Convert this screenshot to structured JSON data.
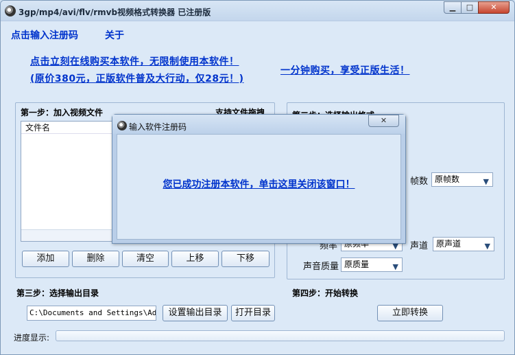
{
  "window": {
    "title": "3gp/mp4/avi/flv/rmvb视频格式转换器  已注册版",
    "min_icon": "▁",
    "max_icon": "□",
    "close_icon": "✕"
  },
  "menu": {
    "register": "点击输入注册码",
    "about": "关于"
  },
  "promo": {
    "line1": "点击立刻在线购买本软件，无限制使用本软件！",
    "line2": "(原价380元，正版软件普及大行动，仅28元！)",
    "right": "一分钟购买，享受正版生活！"
  },
  "step1": {
    "title": "第一步：加入视频文件",
    "drag_hint": "支持文件拖拽",
    "column_filename": "文件名",
    "buttons": {
      "add": "添加",
      "delete": "删除",
      "clear": "清空",
      "up": "上移",
      "down": "下移"
    }
  },
  "step2": {
    "title": "第二步：选择输出格式",
    "fps_label": "帧数",
    "fps_value": "原帧数",
    "rate_label": "频率",
    "rate_value": "原频率",
    "channel_label": "声道",
    "channel_value": "原声道",
    "quality_label": "声音质量",
    "quality_value": "原质量"
  },
  "step3": {
    "title": "第三步：选择输出目录",
    "path": "C:\\Documents and Settings\\Administrator\\桌面",
    "set_dir": "设置输出目录",
    "open_dir": "打开目录"
  },
  "step4": {
    "title": "第四步：开始转换",
    "convert": "立即转换"
  },
  "progress": {
    "label": "进度显示:",
    "percent": 0
  },
  "dialog": {
    "title": "输入软件注册码",
    "close_icon": "✕",
    "message": "您已成功注册本软件，单击这里关闭该窗口！"
  }
}
